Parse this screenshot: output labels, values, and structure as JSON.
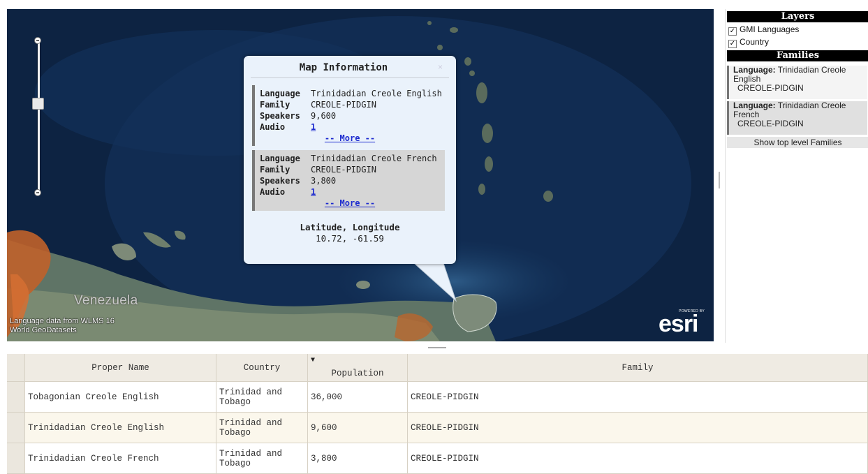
{
  "map": {
    "country_label": "Venezuela",
    "attribution_line1": "Language data from WLMS 16",
    "attribution_line2": "World GeoDatasets",
    "logo_powered": "POWERED BY",
    "logo_word": "esri",
    "colors": {
      "ocean": "#10284a",
      "land": "#6b7f6a",
      "highlight": "#c0622a"
    }
  },
  "popup": {
    "title": "Map Information",
    "close": "×",
    "labels": {
      "language": "Language",
      "family": "Family",
      "speakers": "Speakers",
      "audio": "Audio"
    },
    "entries": [
      {
        "language": "Trinidadian Creole English",
        "family": "CREOLE-PIDGIN",
        "speakers": "9,600",
        "audio": "1",
        "more": "-- More --"
      },
      {
        "language": "Trinidadian Creole French",
        "family": "CREOLE-PIDGIN",
        "speakers": "3,800",
        "audio": "1",
        "more": "-- More --"
      }
    ],
    "latlon_label": "Latitude, Longitude",
    "latlon_value": "10.72, -61.59"
  },
  "panel": {
    "layers_header": "Layers",
    "layers": [
      {
        "label": "GMI Languages",
        "checked": true
      },
      {
        "label": "Country",
        "checked": true
      }
    ],
    "families_header": "Families",
    "family_items": [
      {
        "key": "Language:",
        "language": "Trinidadian Creole English",
        "family": "CREOLE-PIDGIN"
      },
      {
        "key": "Language:",
        "language": "Trinidadian Creole French",
        "family": "CREOLE-PIDGIN"
      }
    ],
    "show_top": "Show top level Families"
  },
  "table": {
    "columns": [
      "Proper Name",
      "Country",
      "Population",
      "Family"
    ],
    "sort_indicator": "▼",
    "rows": [
      {
        "name": "Tobagonian Creole English",
        "country_line1": "Trinidad and",
        "country_line2": "Tobago",
        "population": "36,000",
        "family": "CREOLE-PIDGIN"
      },
      {
        "name": "Trinidadian Creole English",
        "country_line1": "Trinidad and",
        "country_line2": "Tobago",
        "population": "9,600",
        "family": "CREOLE-PIDGIN"
      },
      {
        "name": "Trinidadian Creole French",
        "country_line1": "Trinidad and",
        "country_line2": "Tobago",
        "population": "3,800",
        "family": "CREOLE-PIDGIN"
      }
    ]
  }
}
